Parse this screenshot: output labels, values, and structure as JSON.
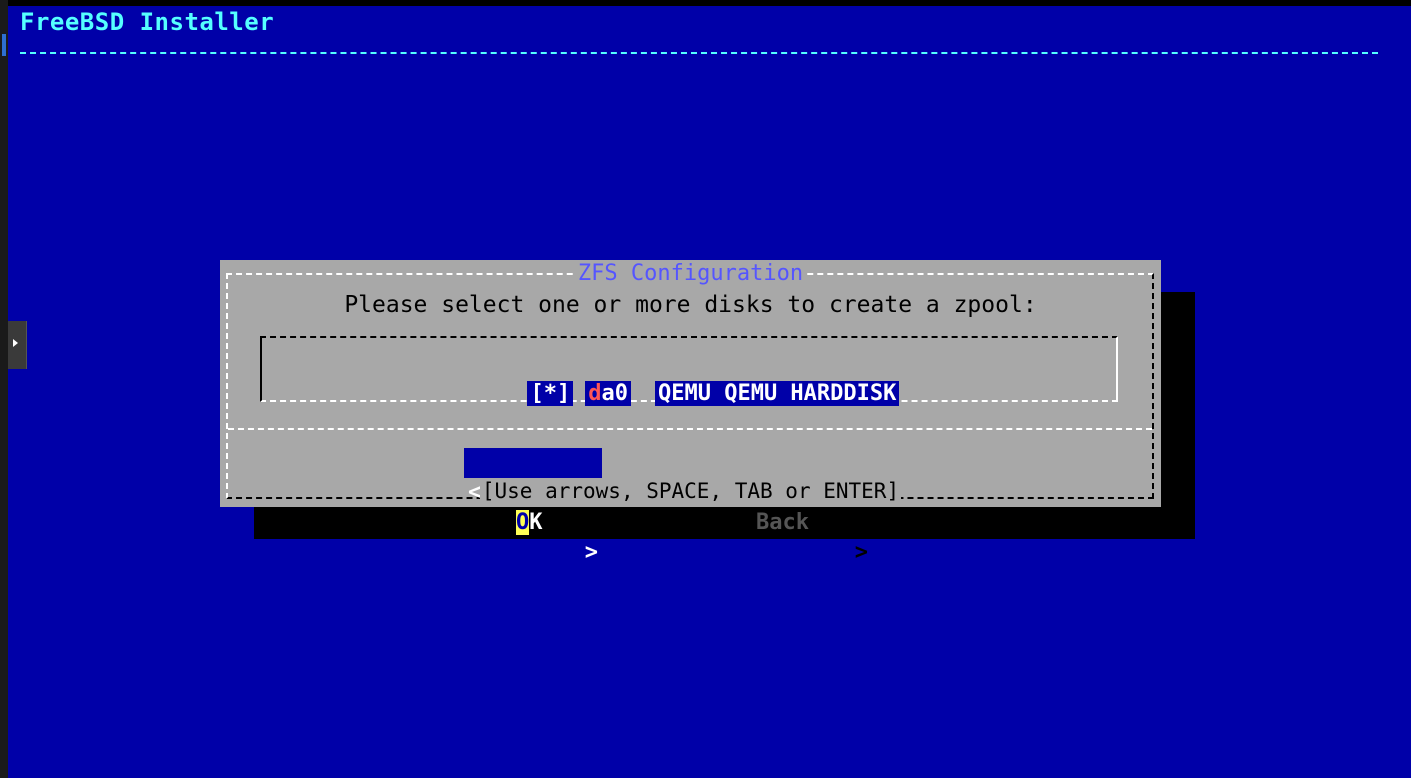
{
  "app": {
    "title": "FreeBSD Installer"
  },
  "dialog": {
    "title": "ZFS Configuration",
    "prompt": "Please select one or more disks to create a zpool:",
    "disks": [
      {
        "checkbox": "[*]",
        "name_hotkey": "d",
        "name_rest": "a0",
        "description": "QEMU QEMU HARDDISK",
        "checked": true
      }
    ],
    "buttons": {
      "ok": {
        "left": "<",
        "hotkey": "O",
        "rest": "K",
        "right": ">"
      },
      "back": {
        "left": "<",
        "label": "Back",
        "right": ">"
      }
    },
    "hint": "[Use arrows, SPACE, TAB or ENTER]"
  },
  "colors": {
    "background": "#0000a8",
    "dialog": "#a8a8a8",
    "title": "#55ffff",
    "dialog_title": "#5555ff",
    "highlight": "#ffff55",
    "hotkey_red": "#ff5555"
  },
  "icons": {
    "side_handle": "chevron-right-icon"
  }
}
